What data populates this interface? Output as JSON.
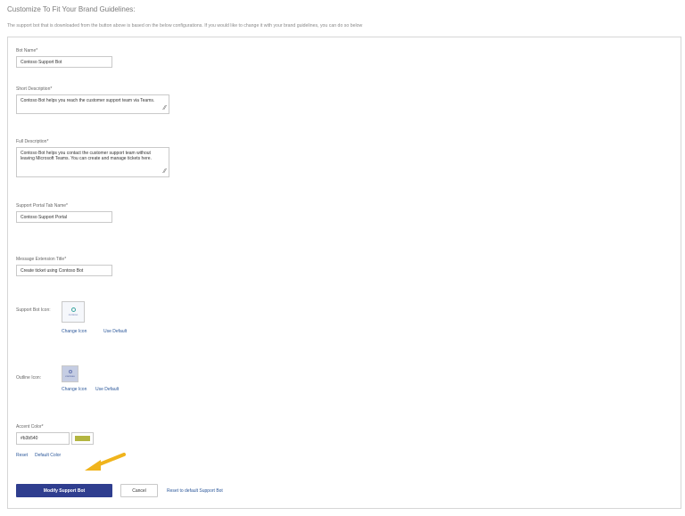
{
  "page": {
    "heading": "Customize To Fit Your Brand Guidelines:",
    "intro": "The support bot that is downloaded from the button above is based on the below configurations. If you would like to change it with your brand guidelines, you can do so below"
  },
  "form": {
    "bot_name": {
      "label": "Bot Name*",
      "value": "Contoso Support Bot"
    },
    "short_description": {
      "label": "Short Description*",
      "value": "Contoso Bot helps you reach the customer support team via Teams."
    },
    "full_description": {
      "label": "Full Description*",
      "value": "Contoso Bot helps you contact the customer support team without leaving Microsoft Teams. You can create and manage tickets here."
    },
    "tab_name": {
      "label": "Support Portal Tab Name*",
      "value": "Contoso Support Portal"
    },
    "message_extension_title": {
      "label": "Message Extension Title*",
      "value": "Create ticket using Contoso Bot"
    },
    "support_bot_icon": {
      "label": "Support Bot Icon:",
      "logo_text": "contoso",
      "change": "Change Icon",
      "use_default": "Use Default"
    },
    "outline_icon": {
      "label": "Outline Icon:",
      "logo_text": "contoso",
      "change": "Change Icon",
      "use_default": "Use Default"
    },
    "accent_color": {
      "label": "Accent Color*",
      "value": "#b3b540",
      "swatch_color": "#b3b540",
      "reset": "Reset",
      "default": "Default Color"
    }
  },
  "actions": {
    "modify": "Modify Support Bot",
    "cancel": "Cancel",
    "reset_default": "Reset to default Support Bot"
  },
  "colors": {
    "primary": "#2f3e8f",
    "link": "#2b579a",
    "arrow": "#f0b41c"
  }
}
